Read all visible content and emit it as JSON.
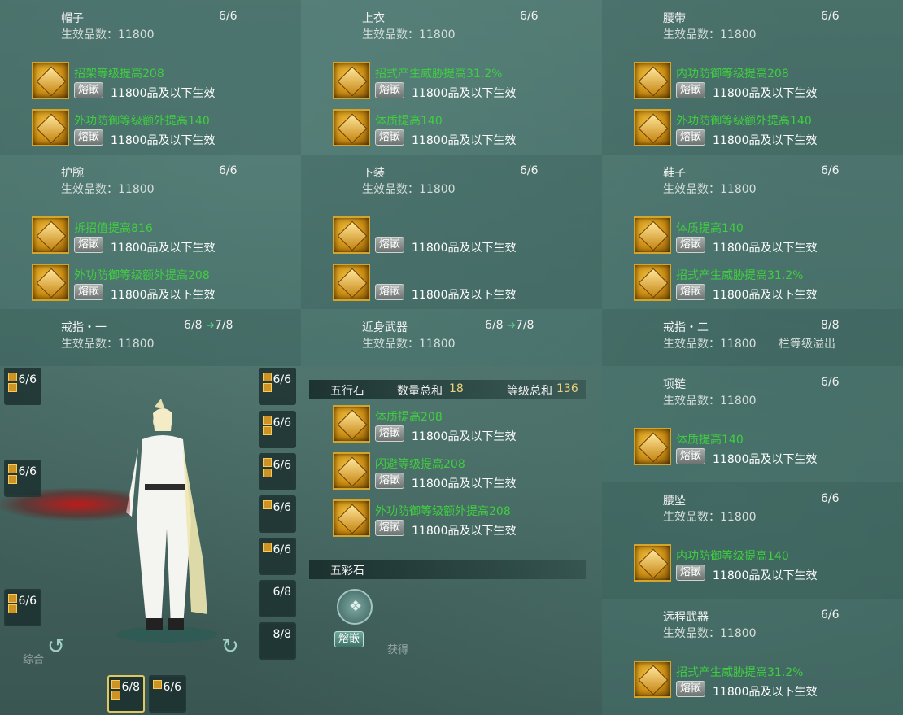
{
  "inlay_label": "熔嵌",
  "inlay_note": "11800品及以下生效",
  "quality_prefix": "生效品数：",
  "slots": {
    "hat": {
      "name": "帽子",
      "count": "6/6",
      "quality": "生效品数：11800",
      "gem1": "招架等级提高208",
      "gem2": "外功防御等级额外提高140"
    },
    "top": {
      "name": "上衣",
      "count": "6/6",
      "quality": "生效品数：11800",
      "gem1": "招式产生威胁提高31.2%",
      "gem2": "体质提高140"
    },
    "belt": {
      "name": "腰带",
      "count": "6/6",
      "quality": "生效品数：11800",
      "gem1": "内功防御等级提高208",
      "gem2": "外功防御等级额外提高140"
    },
    "wrist": {
      "name": "护腕",
      "count": "6/6",
      "quality": "生效品数：11800",
      "gem1": "拆招值提高816",
      "gem2": "外功防御等级额外提高208"
    },
    "pants": {
      "name": "下装",
      "count": "6/6",
      "quality": "生效品数：11800",
      "gem1": "",
      "gem2": ""
    },
    "shoes": {
      "name": "鞋子",
      "count": "6/6",
      "quality": "生效品数：11800",
      "gem1": "体质提高140",
      "gem2": "招式产生威胁提高31.2%"
    },
    "ring1": {
      "name": "戒指・一",
      "count": "6/8",
      "upgrade": "7/8",
      "quality": "生效品数：11800"
    },
    "melee": {
      "name": "近身武器",
      "count": "6/8",
      "upgrade": "7/8",
      "quality": "生效品数：11800"
    },
    "ring2": {
      "name": "戒指・二",
      "count": "8/8",
      "quality": "生效品数：11800",
      "overflow": "栏等级溢出"
    },
    "necklace": {
      "name": "项链",
      "count": "6/6",
      "quality": "生效品数：11800",
      "gem1": "体质提高140"
    },
    "pendant": {
      "name": "腰坠",
      "count": "6/6",
      "quality": "生效品数：11800",
      "gem1": "内功防御等级提高140"
    },
    "ranged": {
      "name": "远程武器",
      "count": "6/6",
      "quality": "生效品数：11800",
      "gem1": "招式产生威胁提高31.2%"
    }
  },
  "wuxing": {
    "title": "五行石",
    "count_label": "数量总和",
    "count_value": "18",
    "level_label": "等级总和",
    "level_value": "136",
    "gems": [
      "体质提高208",
      "闪避等级提高208",
      "外功防御等级额外提高208"
    ]
  },
  "wucai": {
    "title": "五彩石"
  },
  "char_slots": [
    "6/6",
    "6/6",
    "6/6",
    "6/6",
    "6/6",
    "6/6",
    "6/6",
    "6/6",
    "6/8",
    "8/8",
    "6/8",
    "6/6"
  ],
  "background_text": [
    "综合",
    "获得"
  ]
}
